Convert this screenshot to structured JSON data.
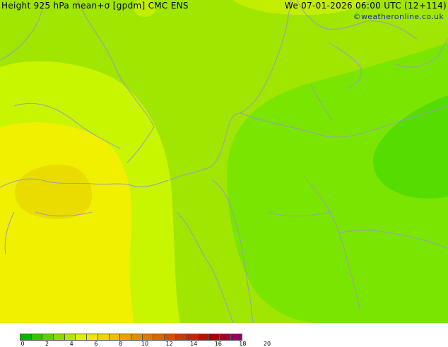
{
  "title": "Height 925 hPa mean+σ [gpdm] CMC ENS",
  "datetime": "We 07-01-2026 06:00 UTC (12+114)",
  "credit": "©weatheronline.co.uk",
  "colorbar": {
    "ticks": [
      "0",
      "2",
      "4",
      "6",
      "8",
      "10",
      "12",
      "14",
      "16",
      "18",
      "20"
    ],
    "colors": [
      "#00b400",
      "#2dc800",
      "#5ad200",
      "#87dc00",
      "#b4e600",
      "#e1f000",
      "#f5e600",
      "#f5d200",
      "#f0be00",
      "#f0a000",
      "#e68c00",
      "#e17800",
      "#dc6400",
      "#d25000",
      "#c83c00",
      "#be2800",
      "#b41400",
      "#aa0000",
      "#a00032",
      "#960064"
    ]
  },
  "field_colors": {
    "light_green": "#a0e600",
    "green": "#7ae600",
    "dark_green": "#55dc00",
    "yellow_green": "#c8f500",
    "yellow": "#f0f000",
    "gold": "#ebdc00"
  }
}
